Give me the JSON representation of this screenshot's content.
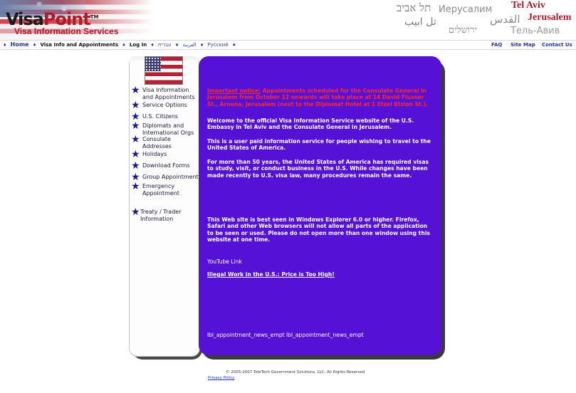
{
  "header": {
    "logo_main": "VisaPoint",
    "logo_tm": "TM",
    "logo_sub": "Visa Information Services",
    "cities": {
      "telaviv_heb": "תל אביב",
      "jerusalem_rus": "Иерусалим",
      "telaviv_eng": "Tel Aviv",
      "telaviv_arb": "تل ابيب",
      "jerusalem_arb": "القدس",
      "jerusalem_eng": "Jerusalem",
      "jerusalem_heb": "ירושלים",
      "telaviv_rus": "Тель-Авив"
    }
  },
  "nav": {
    "home": "Home",
    "visa_info": "Visa Info and Appointments",
    "login": "Log In",
    "lang_arabic": "العربية",
    "lang_hebrew": "עברית",
    "lang_russian": "Русский",
    "sep": "♦",
    "faq": "FAQ",
    "sitemap": "Site Map",
    "contact": "Contact Us"
  },
  "sidebar": {
    "items": [
      {
        "l1": "Visa Information",
        "l2": "and Appointments"
      },
      {
        "l1": "Service Options",
        "l2": ""
      },
      {
        "l1": "U.S. Citizens",
        "l2": ""
      },
      {
        "l1": "Diplomats and",
        "l2": "International Orgs"
      },
      {
        "l1": "Consulate",
        "l2": "Addresses"
      },
      {
        "l1": "Holidays",
        "l2": ""
      },
      {
        "l1": "Download Forms",
        "l2": ""
      },
      {
        "l1": "Group Appointment",
        "l2": ""
      },
      {
        "l1": "Emergency",
        "l2": "Appointment"
      },
      {
        "l1": "Treaty / Trader",
        "l2": "Information"
      }
    ]
  },
  "main": {
    "notice_lead": "Important notice:",
    "notice_body": " Appointments scheduled for the Consulate General in Jerusalem from October 12 onwards will take place at 14 David Flusser St., Arnona, Jerusalem (next to the Diplomat Hotel at 1 Etzel Etzion St.).",
    "welcome": "Welcome to the official Visa Information Service website of the U.S. Embassy in Tel Aviv and the Consulate General in Jerusalem.",
    "paid_service": "This is a user paid information service for people wishing to travel to the United States of America.",
    "history": "For more than 50 years, the United States of America has required visas   to study, visit, or conduct business in the U.S. While changes have been made recently to U.S. visa law, many procedures remain the same.",
    "browser": "This Web site is best seen in Windows Explorer 6.0 or higher. Firefox, Safari and other Web browsers will not allow all parts of the application to be seen or used. Please do not open more than one window using this website at one time.",
    "youtube_label": "YouTube Link",
    "youtube_link": "Illegal Work in the U.S.: Price is Too High!",
    "news_label": "lbl_appointment_news_empt lbl_appointment_news_empt"
  },
  "footer": {
    "copyright": "© 2005-2007 TeleTech Government Solutions, LLC. All Rights Reserved",
    "privacy": "Privacy Policy"
  },
  "colors": {
    "panel": "#5512d6",
    "notice": "#ff2a2a",
    "brand_red": "#b01a2a",
    "nav_blue": "#2233aa"
  }
}
